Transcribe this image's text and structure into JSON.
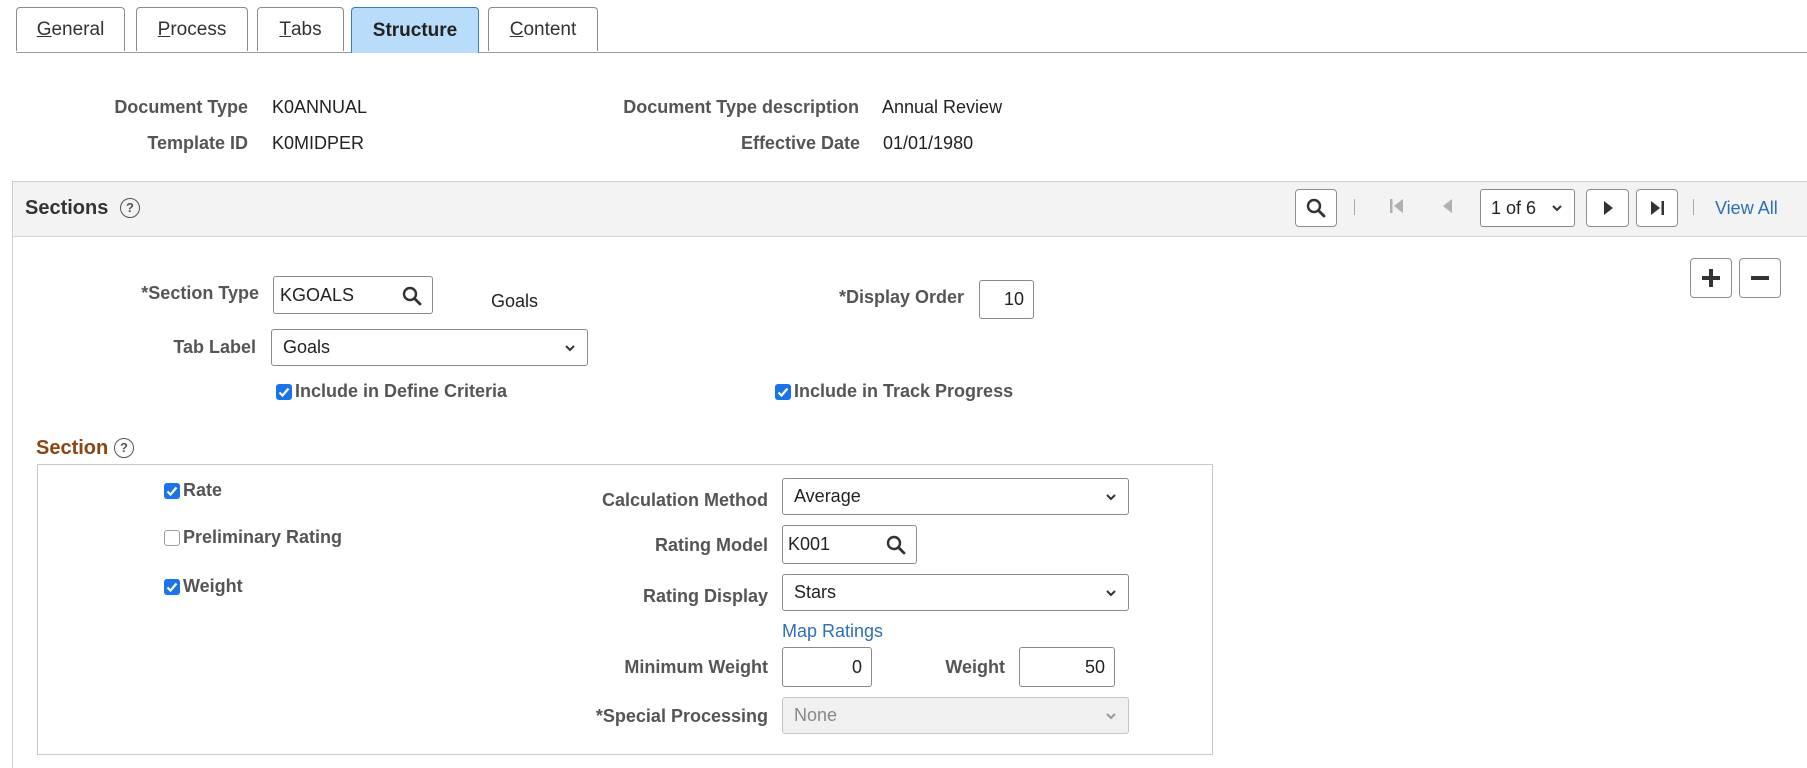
{
  "tabs": [
    {
      "prefix": "",
      "accel": "G",
      "rest": "eneral"
    },
    {
      "prefix": "",
      "accel": "P",
      "rest": "rocess"
    },
    {
      "prefix": "",
      "accel": "T",
      "rest": "abs"
    },
    {
      "prefix": "",
      "accel": "",
      "rest": "Structure"
    },
    {
      "prefix": "",
      "accel": "C",
      "rest": "ontent"
    }
  ],
  "header": {
    "doc_type_label": "Document Type",
    "doc_type_value": "K0ANNUAL",
    "template_label": "Template ID",
    "template_value": "K0MIDPER",
    "doc_desc_label": "Document Type description",
    "doc_desc_value": "Annual Review",
    "eff_date_label": "Effective Date",
    "eff_date_value": "01/01/1980"
  },
  "sections": {
    "title": "Sections",
    "help": "?",
    "pager": "1 of 6",
    "view_all": "View All",
    "section_type_label": "*Section Type",
    "section_type_value": "KGOALS",
    "section_type_desc": "Goals",
    "display_order_label": "*Display Order",
    "display_order_value": "10",
    "tab_label_label": "Tab Label",
    "tab_label_value": "Goals",
    "define_criteria_label": "Include in Define Criteria",
    "track_progress_label": "Include in Track Progress"
  },
  "section": {
    "title": "Section",
    "help": "?",
    "rate_label": "Rate",
    "prelim_label": "Preliminary Rating",
    "weight_check_label": "Weight",
    "calc_method_label": "Calculation Method",
    "calc_method_value": "Average",
    "rating_model_label": "Rating Model",
    "rating_model_value": "K001",
    "rating_display_label": "Rating Display",
    "rating_display_value": "Stars",
    "map_ratings": "Map Ratings",
    "min_weight_label": "Minimum Weight",
    "min_weight_value": "0",
    "weight_label": "Weight",
    "weight_value": "50",
    "special_label": "*Special Processing",
    "special_value": "None"
  },
  "checks": {
    "define_criteria": true,
    "track_progress": true,
    "rate": true,
    "preliminary": false,
    "weight": true
  },
  "colors": {
    "active_tab": "#b8dcf9",
    "checkbox": "#1a73e8",
    "link": "#2e6fb9",
    "section_title": "#8b4513"
  }
}
